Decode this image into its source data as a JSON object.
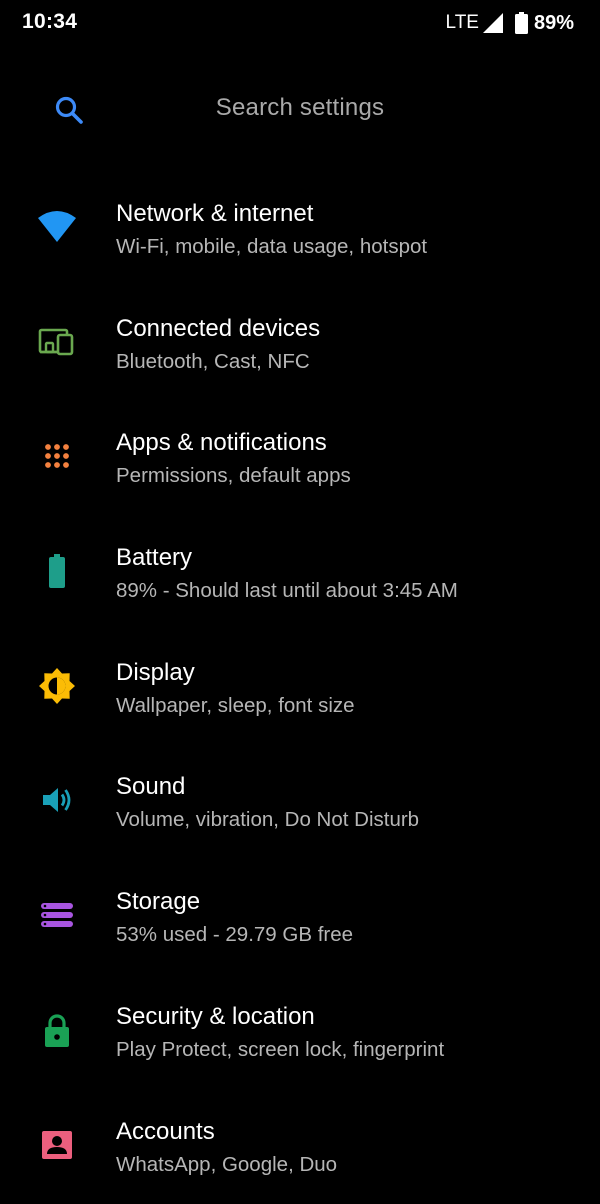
{
  "status_bar": {
    "time": "10:34",
    "network": "LTE",
    "battery": "89%"
  },
  "search": {
    "placeholder": "Search settings",
    "icon": "search-icon"
  },
  "colors": {
    "network": "#2196f3",
    "connected": "#6aa84f",
    "apps": "#f4813f",
    "battery": "#1e9e8a",
    "display": "#fbbc05",
    "sound": "#19a0b8",
    "storage": "#a855e0",
    "security": "#1aa155",
    "accounts": "#ec5f7e"
  },
  "settings": [
    {
      "title": "Network & internet",
      "subtitle": "Wi-Fi, mobile, data usage, hotspot",
      "icon": "wifi-icon"
    },
    {
      "title": "Connected devices",
      "subtitle": "Bluetooth, Cast, NFC",
      "icon": "devices-icon"
    },
    {
      "title": "Apps & notifications",
      "subtitle": "Permissions, default apps",
      "icon": "apps-grid-icon"
    },
    {
      "title": "Battery",
      "subtitle": "89% - Should last until about 3:45 AM",
      "icon": "battery-icon"
    },
    {
      "title": "Display",
      "subtitle": "Wallpaper, sleep, font size",
      "icon": "brightness-icon"
    },
    {
      "title": "Sound",
      "subtitle": "Volume, vibration, Do Not Disturb",
      "icon": "volume-icon"
    },
    {
      "title": "Storage",
      "subtitle": "53% used - 29.79 GB free",
      "icon": "storage-icon"
    },
    {
      "title": "Security & location",
      "subtitle": "Play Protect, screen lock, fingerprint",
      "icon": "lock-icon"
    },
    {
      "title": "Accounts",
      "subtitle": "WhatsApp, Google, Duo",
      "icon": "account-icon"
    }
  ]
}
